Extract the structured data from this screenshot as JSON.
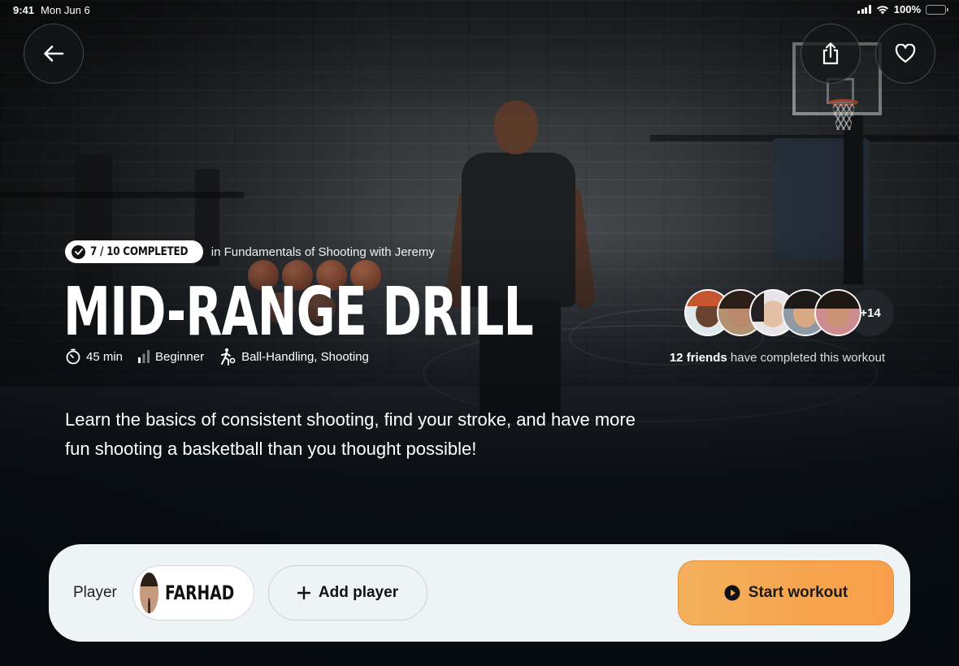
{
  "status_bar": {
    "time": "9:41",
    "date": "Mon Jun 6",
    "battery": "100%",
    "battery_level": 1.0
  },
  "nav": {
    "back_icon": "arrow-left-icon",
    "share_icon": "share-icon",
    "favorite_icon": "heart-icon"
  },
  "progress": {
    "badge": "7 / 10 COMPLETED",
    "completed": 7,
    "total": 10,
    "program": "in Fundamentals of Shooting with Jeremy"
  },
  "workout": {
    "title": "MID-RANGE DRILL",
    "duration": "45 min",
    "level": "Beginner",
    "skills": "Ball-Handling, Shooting",
    "description": "Learn the basics of consistent shooting, find your stroke, and have more fun shooting a basketball than you thought possible!"
  },
  "friends": {
    "more_count": "+14",
    "count_label": "12 friends",
    "suffix": " have completed this workout"
  },
  "bottom_bar": {
    "player_label": "Player",
    "player_name": "FARHAD",
    "add_player": "Add player",
    "start_workout": "Start workout"
  },
  "colors": {
    "accent": "#f6a650",
    "panel": "#eef4f6"
  }
}
